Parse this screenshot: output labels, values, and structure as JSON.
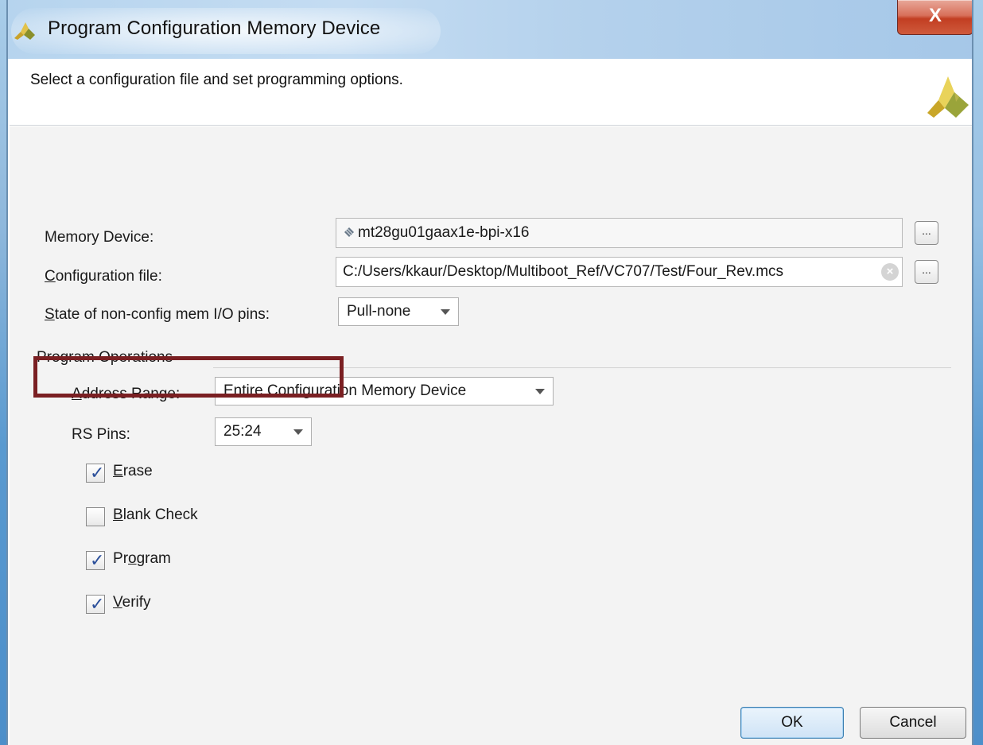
{
  "window": {
    "title": "Program Configuration Memory Device",
    "close_glyph": "X"
  },
  "header": {
    "instruction": "Select a configuration file and set programming options."
  },
  "form": {
    "memory_device": {
      "label": "Memory Device:",
      "value": "mt28gu01gaax1e-bpi-x16",
      "browse": "..."
    },
    "configuration_file": {
      "label_first": "C",
      "label_rest": "onfiguration file:",
      "value": "C:/Users/kkaur/Desktop/Multiboot_Ref/VC707/Test/Four_Rev.mcs",
      "browse": "..."
    },
    "io_pins": {
      "label_first": "S",
      "label_rest": "tate of non-config mem I/O pins:",
      "value": "Pull-none"
    }
  },
  "program_operations": {
    "title": "Program Operations",
    "address_range": {
      "label_first": "A",
      "label_rest": "ddress Range:",
      "value": "Entire Configuration Memory Device"
    },
    "rs_pins": {
      "label": "RS Pins:",
      "value": "25:24"
    },
    "checkboxes": [
      {
        "first": "E",
        "rest": "rase",
        "checked": true
      },
      {
        "first": "B",
        "rest": "lank Check",
        "checked": false
      },
      {
        "first": "P",
        "mid_first": "r",
        "mid_u": "o",
        "rest": "gram",
        "checked": true
      },
      {
        "first": "V",
        "rest": "erify",
        "checked": true
      }
    ]
  },
  "buttons": {
    "ok": "OK",
    "cancel": "Cancel"
  },
  "colors": {
    "highlight_box": "#7a1f22",
    "title_bar": "#b6d4ee",
    "close_button": "#c23e22",
    "checkmark": "#2b4f9a"
  }
}
